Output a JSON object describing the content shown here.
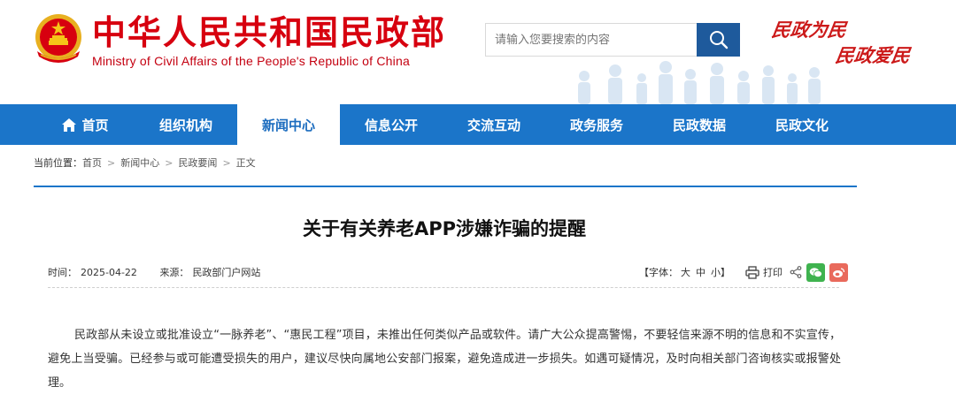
{
  "header": {
    "title": "中华人民共和国民政部",
    "subtitle": "Ministry of Civil Affairs of the People's Republic of China",
    "search_placeholder": "请输入您要搜索的内容",
    "slogan_line1": "民政为民",
    "slogan_line2": "民政爱民",
    "emblem_icon": "national-emblem-icon",
    "search_icon": "search-icon",
    "brand_red": "#d7000f",
    "brand_blue": "#1b75c9"
  },
  "nav": {
    "items": [
      {
        "label": "首页",
        "icon": "home-icon"
      },
      {
        "label": "组织机构"
      },
      {
        "label": "新闻中心",
        "active": true
      },
      {
        "label": "信息公开"
      },
      {
        "label": "交流互动"
      },
      {
        "label": "政务服务"
      },
      {
        "label": "民政数据"
      },
      {
        "label": "民政文化"
      }
    ]
  },
  "breadcrumb": {
    "prefix": "当前位置：",
    "items": [
      "首页",
      "新闻中心",
      "民政要闻",
      "正文"
    ],
    "separator": ">"
  },
  "article": {
    "title": "关于有关养老APP涉嫌诈骗的提醒",
    "time_label": "时间：",
    "time_value": "2025-04-22",
    "source_label": "来源：",
    "source_value": "民政部门户网站",
    "font_label": "【字体：",
    "font_large": "大",
    "font_medium": "中",
    "font_small": "小】",
    "print_label": "打印",
    "body": "民政部从未设立或批准设立“一脉养老”、“惠民工程”项目，未推出任何类似产品或软件。请广大公众提高警惕，不要轻信来源不明的信息和不实宣传，避免上当受骗。已经参与或可能遭受损失的用户，建议尽快向属地公安部门报案，避免造成进一步损失。如遇可疑情况，及时向相关部门咨询核实或报警处理。"
  }
}
